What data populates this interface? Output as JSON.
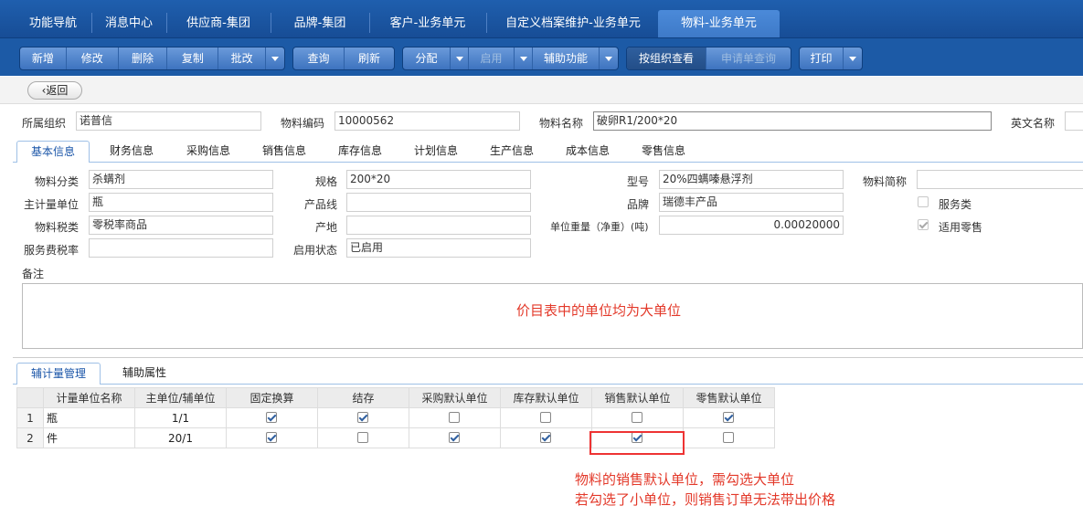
{
  "nav": {
    "tabs": [
      "功能导航",
      "消息中心",
      "供应商-集团",
      "品牌-集团",
      "客户-业务单元",
      "自定义档案维护-业务单元",
      "物料-业务单元"
    ],
    "active_index": 6
  },
  "toolbar": {
    "new": "新增",
    "edit": "修改",
    "delete": "删除",
    "copy": "复制",
    "batch": "批改",
    "query": "查询",
    "refresh": "刷新",
    "assign": "分配",
    "enable": "启用",
    "assist": "辅助功能",
    "by_org": "按组织查看",
    "apply_query": "申请单查询",
    "print": "打印"
  },
  "back_label": "返回",
  "header": {
    "org_label": "所属组织",
    "org_value": "诺普信",
    "code_label": "物料编码",
    "code_value": "10000562",
    "name_label": "物料名称",
    "name_value": "破卵R1/200*20",
    "en_label": "英文名称",
    "en_value": ""
  },
  "tabs": [
    "基本信息",
    "财务信息",
    "采购信息",
    "销售信息",
    "库存信息",
    "计划信息",
    "生产信息",
    "成本信息",
    "零售信息"
  ],
  "basic": {
    "category_label": "物料分类",
    "category_value": "杀螨剂",
    "unit_label": "主计量单位",
    "unit_value": "瓶",
    "tax_label": "物料税类",
    "tax_value": "零税率商品",
    "service_tax_label": "服务费税率",
    "service_tax_value": "",
    "spec_label": "规格",
    "spec_value": "200*20",
    "line_label": "产品线",
    "line_value": "",
    "origin_label": "产地",
    "origin_value": "",
    "status_label": "启用状态",
    "status_value": "已启用",
    "model_label": "型号",
    "model_value": "20%四螨嗪悬浮剂",
    "brand_label": "品牌",
    "brand_value": "瑞德丰产品",
    "weight_label": "单位重量（净重）(吨)",
    "weight_value": "0.00020000",
    "short_label": "物料简称",
    "short_value": "",
    "service_label": "服务类",
    "service_checked": false,
    "retail_label": "适用零售",
    "retail_checked": true,
    "remark_label": "备注"
  },
  "annotation_1": "价目表中的单位均为大单位",
  "sub_tabs": [
    "辅计量管理",
    "辅助属性"
  ],
  "grid": {
    "headers": [
      "计量单位名称",
      "主单位/辅单位",
      "固定换算",
      "结存",
      "采购默认单位",
      "库存默认单位",
      "销售默认单位",
      "零售默认单位"
    ],
    "rows": [
      {
        "no": "1",
        "name": "瓶",
        "ratio": "1/1",
        "fixed": true,
        "stock": true,
        "purchase": false,
        "inventory": false,
        "sales": false,
        "retail": true
      },
      {
        "no": "2",
        "name": "件",
        "ratio": "20/1",
        "fixed": true,
        "stock": false,
        "purchase": true,
        "inventory": true,
        "sales": true,
        "retail": false
      }
    ]
  },
  "annotation_2_line1": "物料的销售默认单位，需勾选大单位",
  "annotation_2_line2": "若勾选了小单位，则销售订单无法带出价格",
  "colors": {
    "accent": "#1c5aa6",
    "annotation": "#e3392a"
  }
}
